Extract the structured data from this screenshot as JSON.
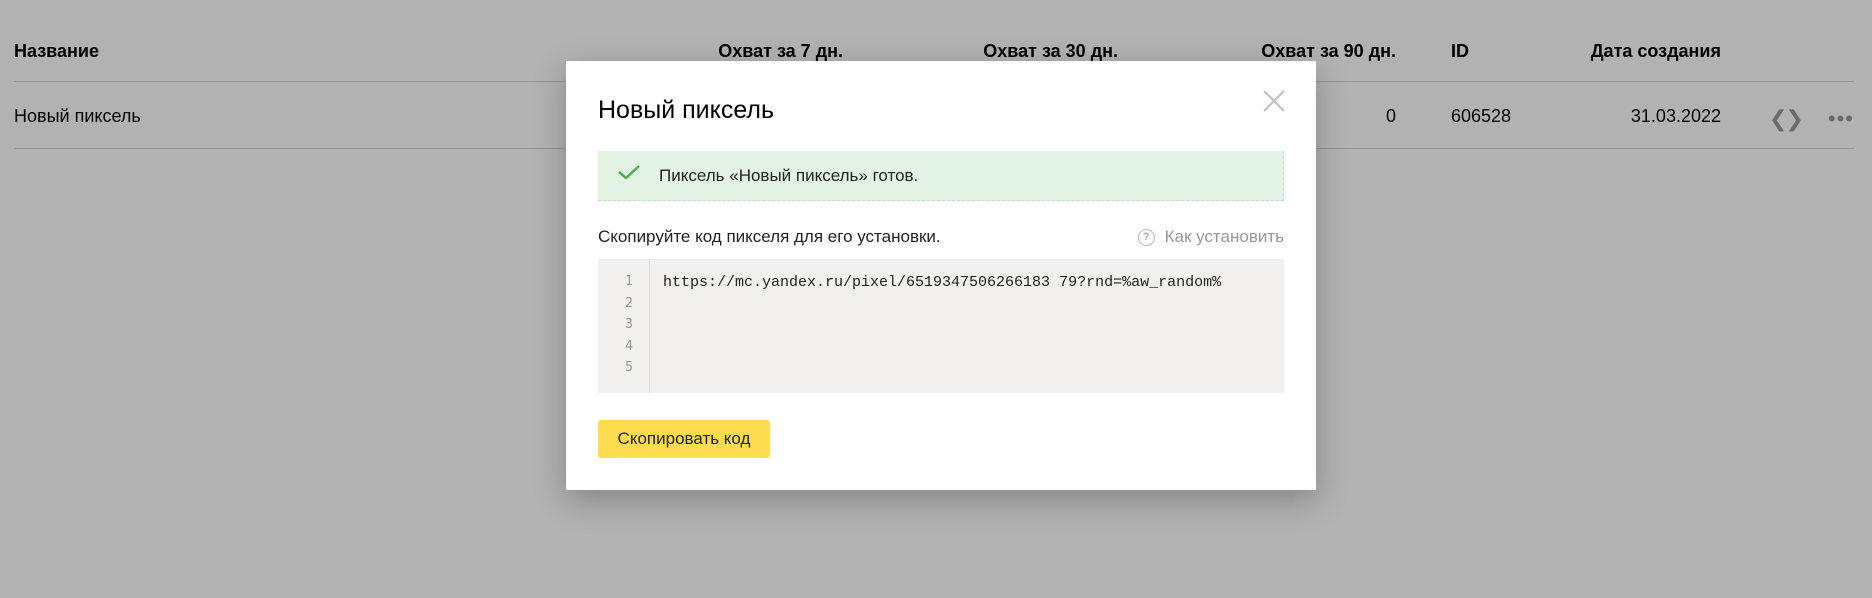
{
  "table": {
    "headers": {
      "name": "Название",
      "reach7": "Охват за 7 дн.",
      "reach30": "Охват за 30 дн.",
      "reach90": "Охват за 90 дн.",
      "id": "ID",
      "created": "Дата создания"
    },
    "rows": [
      {
        "name": "Новый пиксель",
        "reach90": "0",
        "id": "606528",
        "created": "31.03.2022"
      }
    ],
    "row_icons": [
      "code-icon",
      "more-icon"
    ]
  },
  "modal": {
    "title": "Новый пиксель",
    "success_message": "Пиксель «Новый пиксель» готов.",
    "hint": "Скопируйте код пикселя для его установки.",
    "howto_label": "Как установить",
    "code": {
      "line_numbers": [
        "1",
        "2",
        "3",
        "4",
        "5"
      ],
      "line1": "https://mc.yandex.ru/pixel/6519347506266183 79?rnd=%aw_random%"
    },
    "copy_button": "Скопировать код"
  },
  "colors": {
    "accent_button": "#ffdb4d",
    "success_bg": "#e3f3e3",
    "success_check": "#4caf50",
    "code_bg": "#f1f0ee"
  }
}
